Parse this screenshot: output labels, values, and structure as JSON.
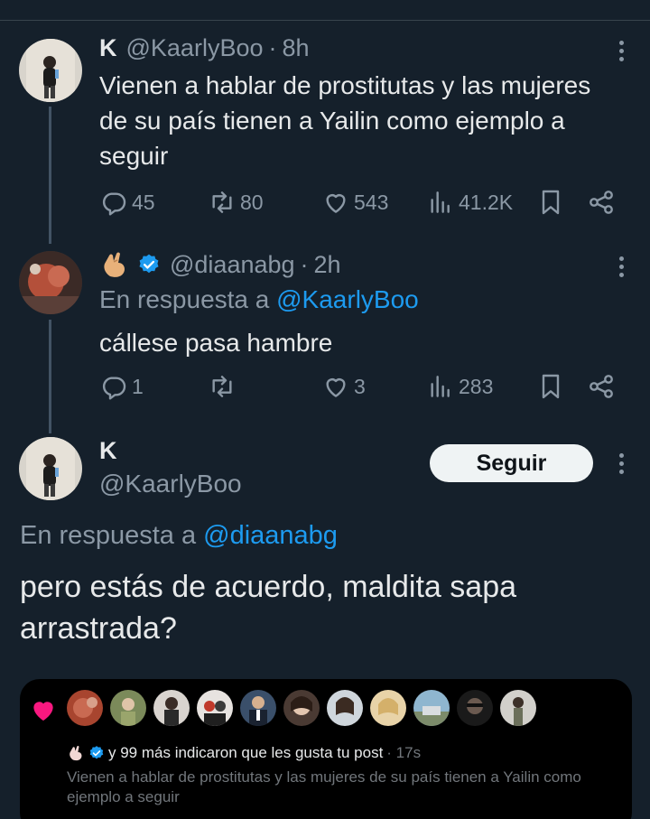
{
  "tweet1": {
    "name": "K",
    "handle": "@KaarlyBoo",
    "separator": "·",
    "time": "8h",
    "text": "Vienen a hablar de prostitutas y las mujeres de su país tienen a Yailin como ejemplo a seguir",
    "replies": "45",
    "retweets": "80",
    "likes": "543",
    "views": "41.2K"
  },
  "tweet2": {
    "name_emoji": "🤌",
    "handle": "@diaanabg",
    "separator": "·",
    "time": "2h",
    "reply_prefix": "En respuesta a",
    "reply_handle": "@KaarlyBoo",
    "text": "cállese pasa hambre",
    "replies": "1",
    "retweets": "",
    "likes": "3",
    "views": "283"
  },
  "main_tweet": {
    "name": "K",
    "handle": "@KaarlyBoo",
    "follow_label": "Seguir",
    "reply_prefix": "En respuesta a",
    "reply_handle": "@diaanabg",
    "text": "pero estás de acuerdo, maldita sapa arrastrada?"
  },
  "notification": {
    "line": "y 99 más indicaron que les gusta tu post",
    "time": "· 17s",
    "body": "Vienen a hablar de prostitutas y las mujeres de su país tienen a Yailin como ejemplo a seguir"
  },
  "colors": {
    "background": "#15202b",
    "link": "#1d9bf0",
    "verified": "#1d9bf0",
    "like_heart": "#f91880"
  },
  "icons": [
    "reply-icon",
    "retweet-icon",
    "like-icon",
    "views-icon",
    "bookmark-icon",
    "share-icon",
    "more-icon",
    "verified-badge-icon",
    "pinched-fingers-emoji"
  ]
}
